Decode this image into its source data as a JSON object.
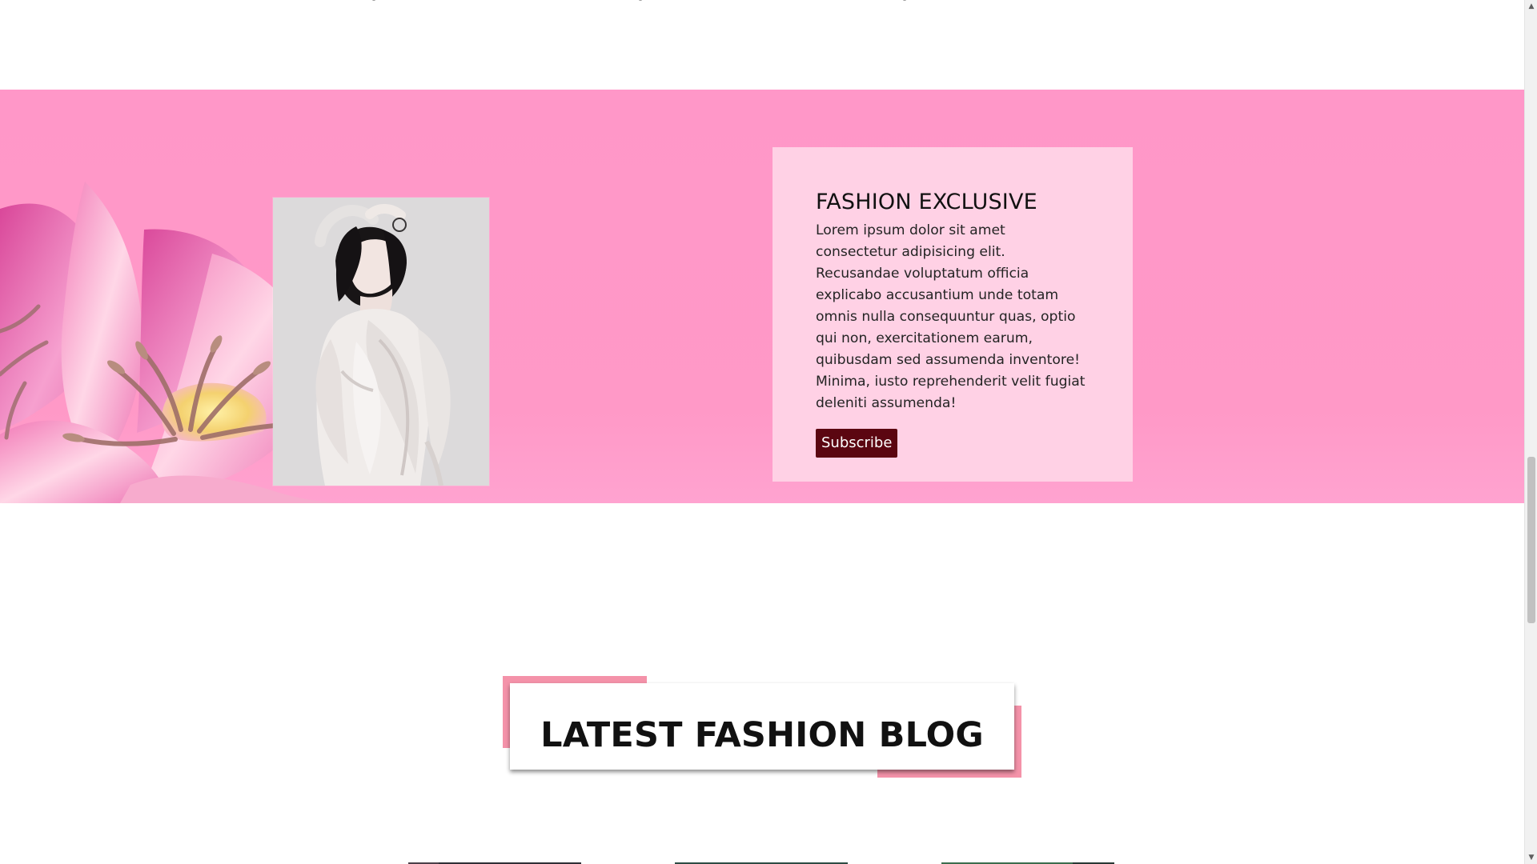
{
  "promo": {
    "title": "FASHION EXCLUSIVE",
    "description": "Lorem ipsum dolor sit amet consectetur adipisicing elit. Recusandae voluptatum officia explicabo accusantium unde totam omnis nulla consequuntur quas, optio qui non, exercitationem earum, quibusdam sed assumenda inventore! Minima, iusto reprehenderit velit fugiat deleniti assumenda!",
    "button_label": "Subscribe",
    "image_subject": "woman in white outfit",
    "decor_subject": "pink lily flower"
  },
  "blog": {
    "title": "LATEST FASHION BLOG"
  },
  "colors": {
    "promo_background": "#ff99c7",
    "info_card_background": "#ffd1e5",
    "button_background": "#5b0611",
    "heading_accent": "#f492a9"
  },
  "scrollbar": {
    "up_icon": "scroll-up-arrow-icon",
    "down_icon": "scroll-down-arrow-icon"
  }
}
